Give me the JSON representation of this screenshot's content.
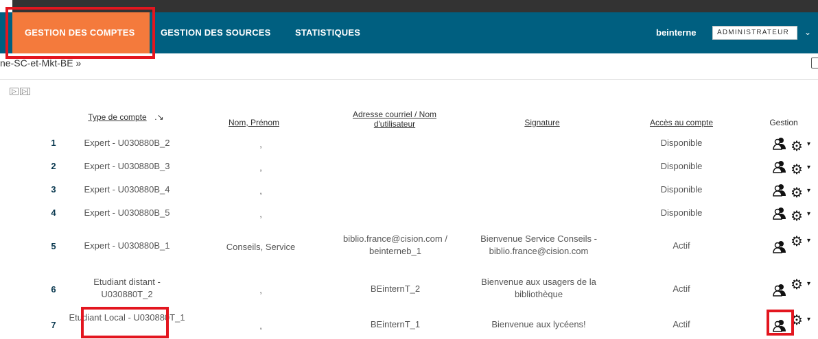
{
  "nav": {
    "tabs": [
      "GESTION DES COMPTES",
      "GESTION DES SOURCES",
      "STATISTIQUES"
    ],
    "user": "beinterne",
    "role": "ADMINISTRATEUR"
  },
  "breadcrumb": "ne-SC-et-Mkt-BE »",
  "table": {
    "headers": {
      "type": "Type de compte",
      "sort_marker": ".↘",
      "nom": "Nom, Prénom",
      "email_line1": "Adresse courriel / Nom",
      "email_line2": "d'utilisateur",
      "signature": "Signature",
      "acces": "Accès au compte",
      "gestion": "Gestion"
    },
    "rows": [
      {
        "num": "1",
        "type": "Expert - U030880B_2",
        "nom": ",",
        "email": "",
        "signature": "",
        "acces": "Disponible"
      },
      {
        "num": "2",
        "type": "Expert - U030880B_3",
        "nom": ",",
        "email": "",
        "signature": "",
        "acces": "Disponible"
      },
      {
        "num": "3",
        "type": "Expert - U030880B_4",
        "nom": ",",
        "email": "",
        "signature": "",
        "acces": "Disponible"
      },
      {
        "num": "4",
        "type": "Expert - U030880B_5",
        "nom": ",",
        "email": "",
        "signature": "",
        "acces": "Disponible"
      },
      {
        "num": "5",
        "type": "Expert - U030880B_1",
        "nom": "Conseils, Service",
        "email": "biblio.france@cision.com / beinterneb_1",
        "signature": "Bienvenue Service Conseils - biblio.france@cision.com",
        "acces": "Actif"
      },
      {
        "num": "6",
        "type": "Etudiant distant - U030880T_2",
        "nom": ",",
        "email": "BEinternT_2",
        "signature": "Bienvenue aux usagers de la bibliothèque",
        "acces": "Actif"
      },
      {
        "num": "7",
        "type": "Etudiant Local - U030880T_1",
        "nom": ",",
        "email": "BEinternT_1",
        "signature": "Bienvenue aux lycéens!",
        "acces": "Actif"
      }
    ]
  },
  "pager": [
    "▷",
    "▷|"
  ],
  "colors": {
    "navbar": "#005f80",
    "active_tab": "#f47a3c",
    "highlight": "#e3161f"
  }
}
